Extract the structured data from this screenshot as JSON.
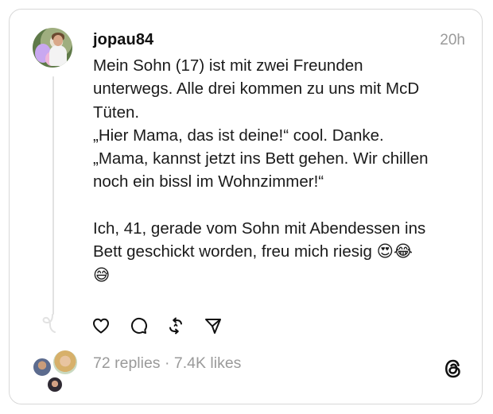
{
  "post": {
    "username": "jopau84",
    "time": "20h",
    "lines": [
      "Mein Sohn (17) ist mit zwei Freunden",
      "unterwegs. Alle drei kommen zu uns mit McD",
      "Tüten.",
      "„Hier Mama, das ist deine!“ cool. Danke.",
      "„Mama, kannst jetzt ins Bett gehen. Wir chillen",
      "noch ein bissl im Wohnzimmer!“",
      "",
      "Ich, 41, gerade vom Sohn mit Abendessen ins",
      "Bett geschickt worden, freu mich riesig 😍😂",
      "😅"
    ],
    "stats": "72 replies · 7.4K likes"
  },
  "icons": {
    "like": "heart-icon",
    "reply": "comment-icon",
    "repost": "repost-icon",
    "share": "send-icon",
    "logo": "threads-logo-icon"
  },
  "colors": {
    "text": "#101010",
    "secondary": "#9a9a9a",
    "border": "#d8d8d8"
  }
}
